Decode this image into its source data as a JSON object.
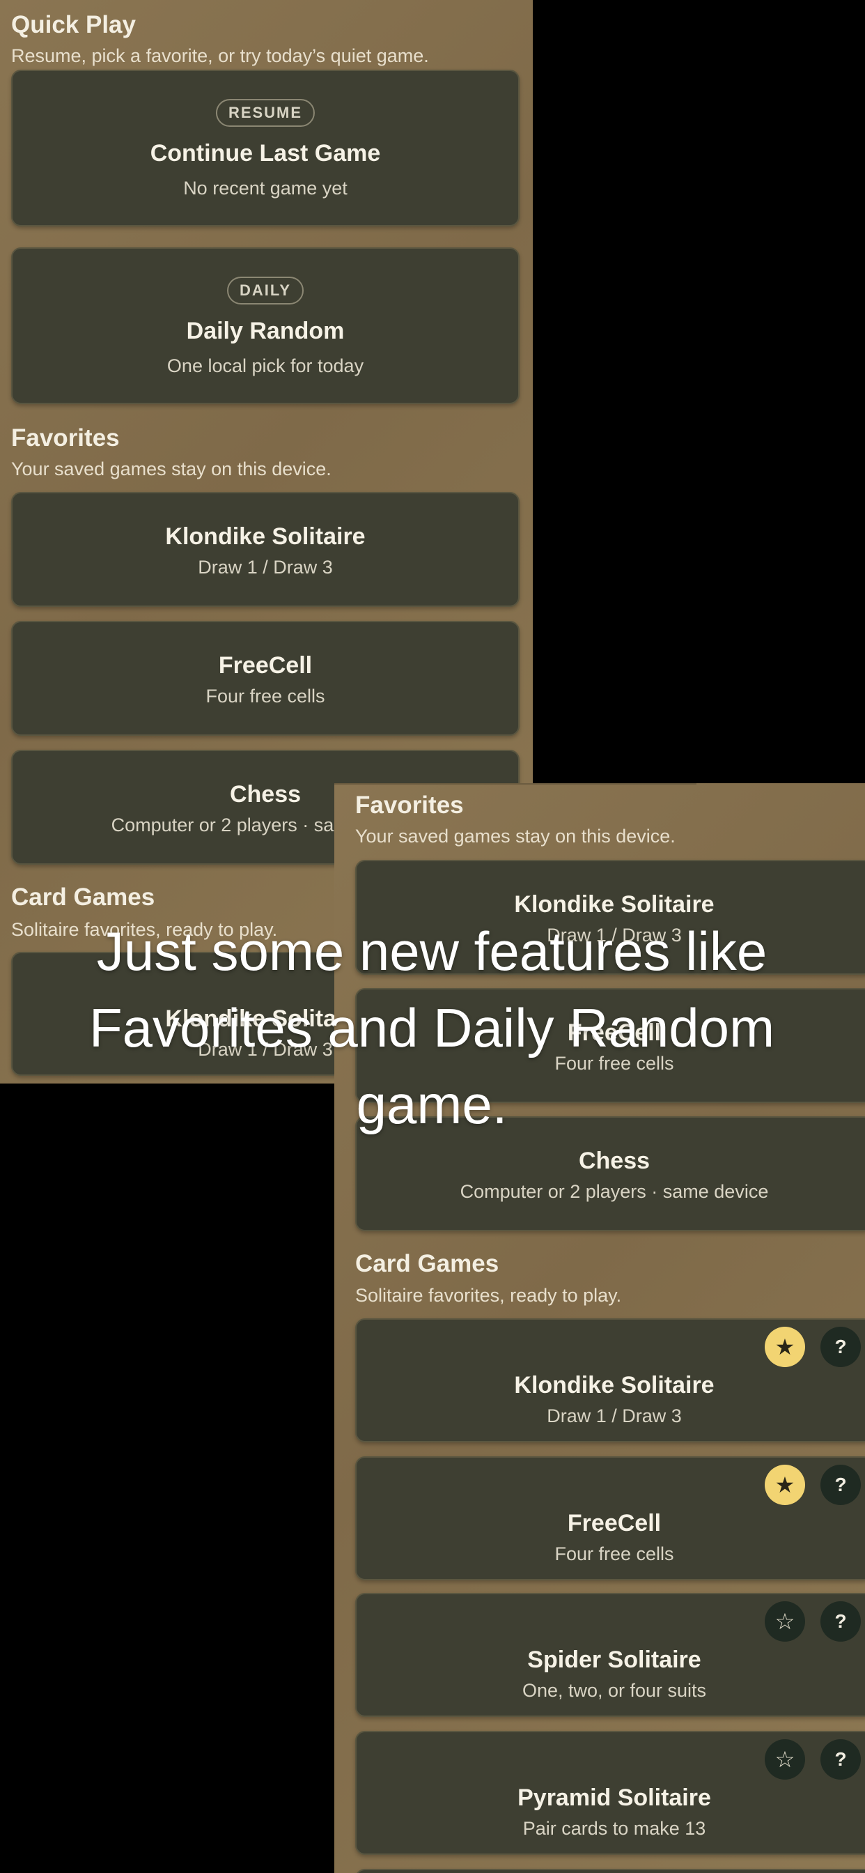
{
  "left_panel": {
    "quick_play": {
      "title": "Quick Play",
      "subtitle": "Resume, pick a favorite, or try today’s quiet game.",
      "resume_card": {
        "badge": "RESUME",
        "title": "Continue Last Game",
        "subtitle": "No recent game yet"
      },
      "daily_card": {
        "badge": "DAILY",
        "title": "Daily Random",
        "subtitle": "One local pick for today"
      }
    },
    "favorites": {
      "title": "Favorites",
      "subtitle": "Your saved games stay on this device.",
      "items": [
        {
          "title": "Klondike Solitaire",
          "subtitle": "Draw 1 / Draw 3"
        },
        {
          "title": "FreeCell",
          "subtitle": "Four free cells"
        },
        {
          "title": "Chess",
          "subtitle": "Computer or 2 players · same device"
        }
      ]
    },
    "card_games": {
      "title": "Card Games",
      "subtitle": "Solitaire favorites, ready to play.",
      "items": [
        {
          "title": "Klondike Solitaire",
          "subtitle": "Draw 1 / Draw 3"
        }
      ]
    }
  },
  "right_panel": {
    "favorites": {
      "title": "Favorites",
      "subtitle": "Your saved games stay on this device.",
      "items": [
        {
          "title": "Klondike Solitaire",
          "subtitle": "Draw 1 / Draw 3"
        },
        {
          "title": "FreeCell",
          "subtitle": "Four free cells"
        },
        {
          "title": "Chess",
          "subtitle": "Computer or 2 players · same device"
        }
      ]
    },
    "card_games": {
      "title": "Card Games",
      "subtitle": "Solitaire favorites, ready to play.",
      "items": [
        {
          "title": "Klondike Solitaire",
          "subtitle": "Draw 1 / Draw 3",
          "favorite_glyph": "★",
          "favorited": true,
          "help_glyph": "?"
        },
        {
          "title": "FreeCell",
          "subtitle": "Four free cells",
          "favorite_glyph": "★",
          "favorited": true,
          "help_glyph": "?"
        },
        {
          "title": "Spider Solitaire",
          "subtitle": "One, two, or four suits",
          "favorite_glyph": "☆",
          "favorited": false,
          "help_glyph": "?"
        },
        {
          "title": "Pyramid Solitaire",
          "subtitle": "Pair cards to make 13",
          "favorite_glyph": "☆",
          "favorited": false,
          "help_glyph": "?"
        }
      ]
    }
  },
  "overlay_caption": "Just some new features like Favorites and Daily Random game.",
  "colors": {
    "panel_background": "#85704d",
    "card_background": "#3e3f32",
    "star_active": "#f2d472",
    "icon_button_dark": "#1f2a22",
    "text_primary": "#f6f2e6"
  },
  "icons": {
    "favorite_on": "star-filled-icon",
    "favorite_off": "star-outline-icon",
    "help": "question-icon"
  }
}
